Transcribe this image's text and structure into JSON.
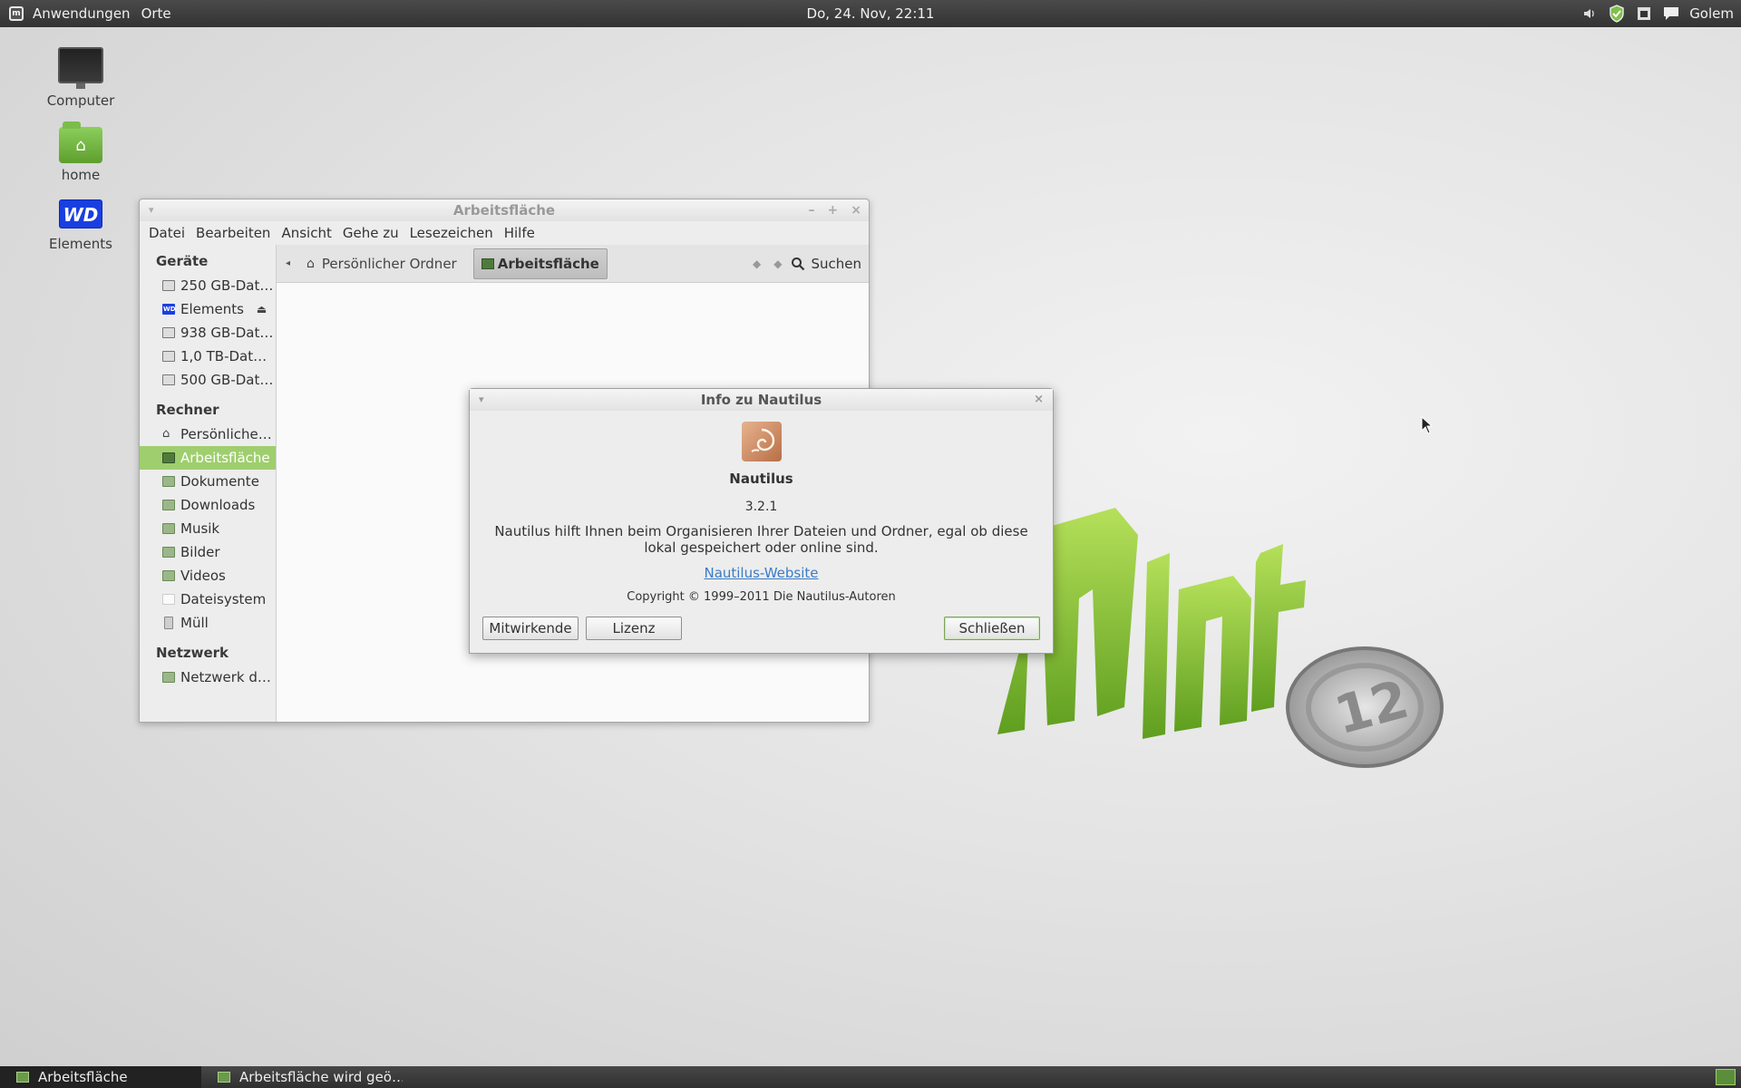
{
  "top_panel": {
    "menus": [
      "Anwendungen",
      "Orte"
    ],
    "clock": "Do, 24. Nov, 22:11",
    "user": "Golem",
    "tray_icons": [
      "volume-icon",
      "shield-icon",
      "network-icon",
      "chat-icon"
    ]
  },
  "desktop_icons": [
    {
      "label": "Computer",
      "icon": "computer-icon"
    },
    {
      "label": "home",
      "icon": "home-folder-icon"
    },
    {
      "label": "Elements",
      "icon": "wd-drive-icon"
    }
  ],
  "window": {
    "title": "Arbeitsfläche",
    "menubar": [
      "Datei",
      "Bearbeiten",
      "Ansicht",
      "Gehe zu",
      "Lesezeichen",
      "Hilfe"
    ],
    "sidebar": {
      "devices_header": "Geräte",
      "devices": [
        "250 GB-Dat…",
        "Elements",
        "938 GB-Dat…",
        "1,0 TB-Dat…",
        "500 GB-Dat…"
      ],
      "computer_header": "Rechner",
      "places": [
        "Persönliche…",
        "Arbeitsfläche",
        "Dokumente",
        "Downloads",
        "Musik",
        "Bilder",
        "Videos",
        "Dateisystem",
        "Müll"
      ],
      "network_header": "Netzwerk",
      "network": [
        "Netzwerk d…"
      ]
    },
    "pathbar": {
      "home_crumb": "Persönlicher Ordner",
      "current_crumb": "Arbeitsfläche",
      "search_label": "Suchen"
    }
  },
  "about_dialog": {
    "title": "Info zu Nautilus",
    "app_name": "Nautilus",
    "version": "3.2.1",
    "description": "Nautilus hilft Ihnen beim Organisieren Ihrer Dateien und Ordner, egal ob diese lokal gespeichert oder online sind.",
    "website_label": "Nautilus-Website",
    "copyright": "Copyright © 1999–2011 Die Nautilus-Autoren",
    "buttons": {
      "credits": "Mitwirkende",
      "license": "Lizenz",
      "close": "Schließen"
    }
  },
  "taskbar": {
    "tasks": [
      "Arbeitsfläche",
      "Arbeitsfläche wird geö…"
    ]
  },
  "colors": {
    "accent_green": "#9fce6e",
    "link_blue": "#3a7cc7",
    "panel_dark": "#333333"
  }
}
